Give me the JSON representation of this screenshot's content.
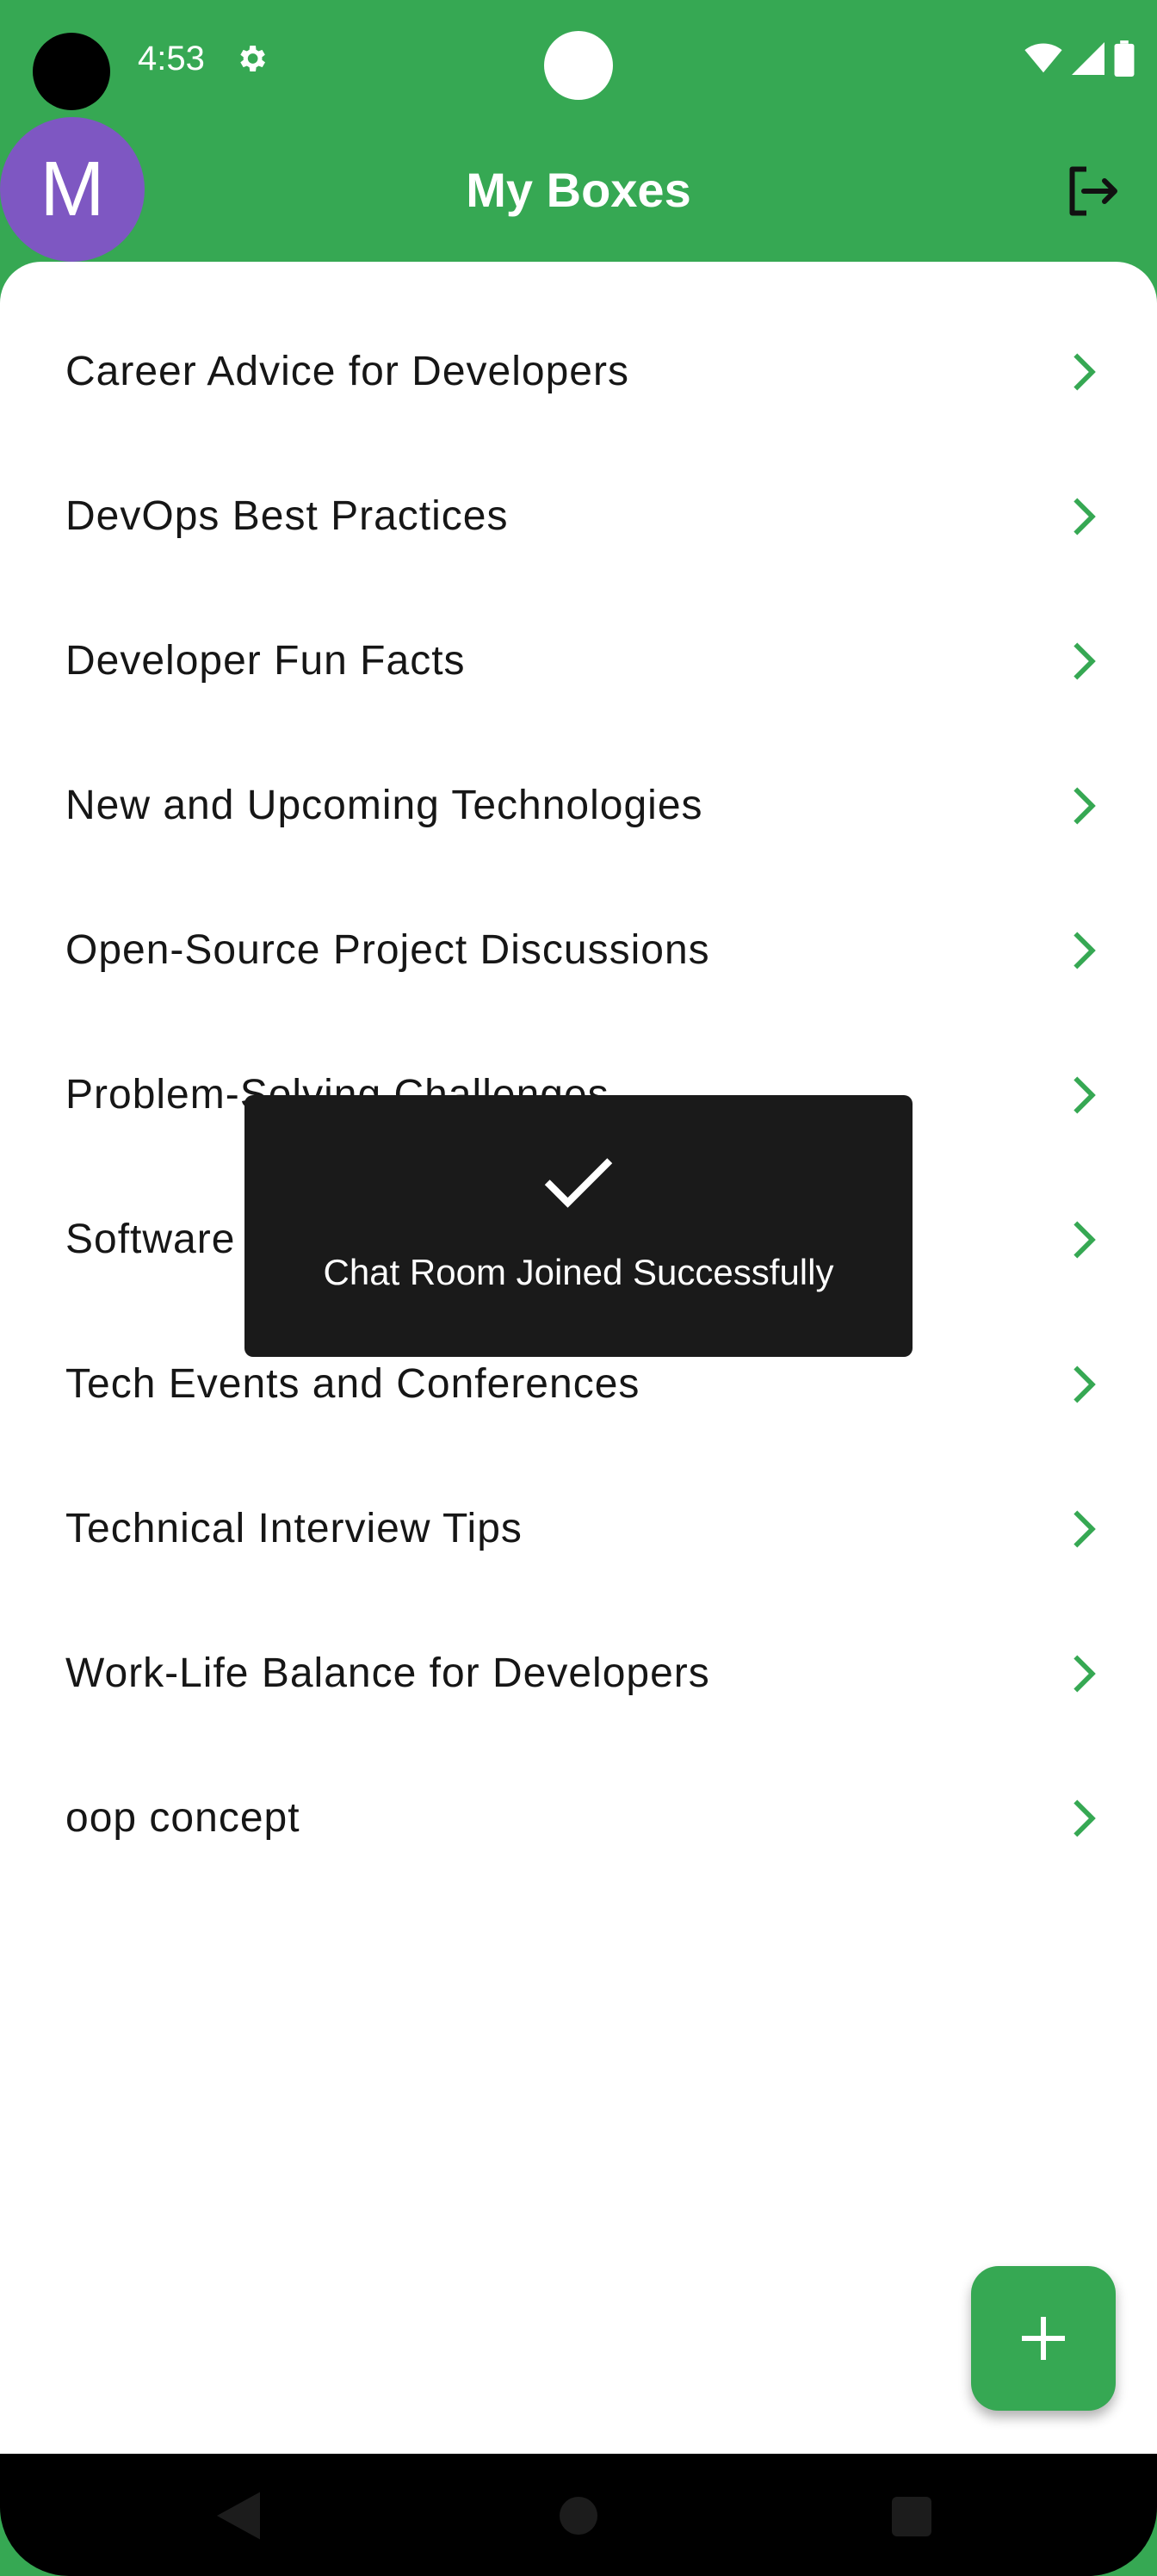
{
  "status_bar": {
    "time": "4:53",
    "icons": [
      "settings-icon",
      "wifi-icon",
      "signal-icon",
      "battery-icon"
    ]
  },
  "app_bar": {
    "avatar_letter": "M",
    "title": "My Boxes",
    "logout_icon": "logout-icon"
  },
  "boxes": [
    "Career Advice for Developers",
    "DevOps Best Practices",
    "Developer Fun Facts",
    "New and Upcoming Technologies",
    "Open-Source Project Discussions",
    "Problem-Solving Challenges",
    "Software Development Humor",
    "Tech Events and Conferences",
    "Technical Interview Tips",
    "Work-Life Balance for Developers",
    "oop concept"
  ],
  "toast": {
    "icon": "checkmark-icon",
    "message": "Chat Room Joined Successfully"
  },
  "fab": {
    "icon": "plus-icon"
  },
  "nav_bar": {
    "icons": [
      "back-icon",
      "home-icon",
      "recents-icon"
    ]
  },
  "colors": {
    "primary": "#36a853",
    "avatar": "#7e57c2",
    "toast_bg": "#1a1a1a"
  }
}
